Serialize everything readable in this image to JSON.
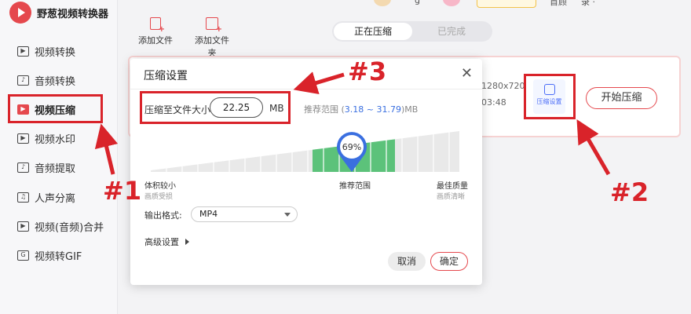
{
  "app": {
    "name": "野葱视频转换器"
  },
  "sidebar": {
    "items": [
      {
        "label": "视频转换",
        "icon": "video-convert-icon"
      },
      {
        "label": "音频转换",
        "icon": "audio-convert-icon"
      },
      {
        "label": "视频压缩",
        "icon": "video-compress-icon",
        "active": true
      },
      {
        "label": "视频水印",
        "icon": "watermark-icon"
      },
      {
        "label": "音频提取",
        "icon": "audio-extract-icon"
      },
      {
        "label": "人声分离",
        "icon": "voice-separate-icon"
      },
      {
        "label": "视频(音频)合并",
        "icon": "merge-icon"
      },
      {
        "label": "视频转GIF",
        "icon": "gif-icon"
      }
    ]
  },
  "toolbar": {
    "add_file": "添加文件",
    "add_folder": "添加文件夹"
  },
  "tabs": {
    "active": "正在压缩",
    "inactive": "已完成"
  },
  "topbar": {
    "text_a": "g",
    "text_b": "首顾",
    "text_c": "录 ·"
  },
  "file_card": {
    "resolution": "1280x720",
    "duration": "03:48",
    "compress_settings_label": "压缩设置",
    "start_label": "开始压缩"
  },
  "dialog": {
    "title": "压缩设置",
    "compress_to_label": "压缩至文件大小",
    "size_value": "22.25",
    "size_unit": "MB",
    "range_prefix": "推荐范围 (",
    "range_value": "3.18 ~ 31.79",
    "range_suffix": ")MB",
    "gauge_percent": "69%",
    "scale_left": "体积较小",
    "scale_left_sub": "画质受损",
    "scale_mid": "推荐范围",
    "scale_right": "最佳质量",
    "scale_right_sub": "画质清晰",
    "format_label": "输出格式:",
    "format_value": "MP4",
    "advanced_label": "高级设置",
    "cancel_label": "取消",
    "ok_label": "确定"
  },
  "annotations": {
    "a1": "#1",
    "a2": "#2",
    "a3": "#3"
  },
  "colors": {
    "accent": "#e5484d",
    "annotation": "#d9232a",
    "recommend": "#5cc27a",
    "link": "#3a6fe0"
  }
}
